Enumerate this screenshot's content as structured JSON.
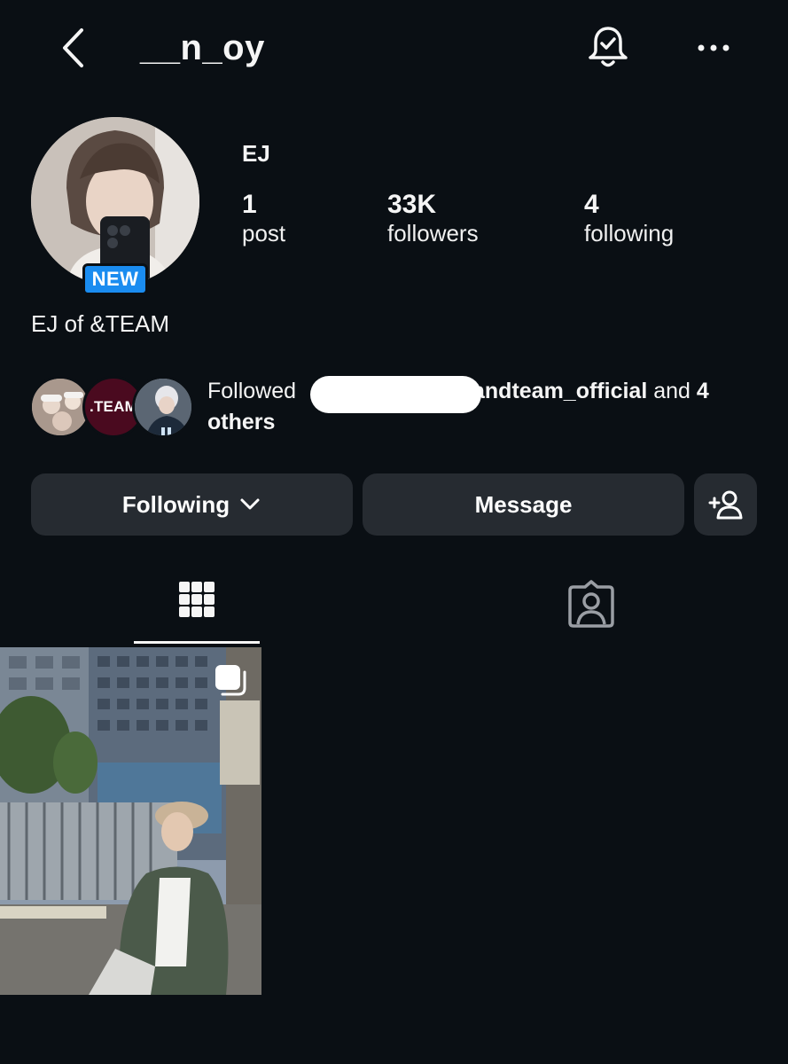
{
  "header": {
    "username": "__n_oy"
  },
  "profile": {
    "display_name": "EJ",
    "badge": "NEW",
    "bio": "EJ of &TEAM",
    "stats": [
      {
        "number": "1",
        "label": "post"
      },
      {
        "number": "33K",
        "label": "followers"
      },
      {
        "number": "4",
        "label": "following"
      }
    ]
  },
  "followed_by": {
    "prefix": "Followed ",
    "account": "andteam_official",
    "middle": " and ",
    "count": "4",
    "suffix": "others",
    "avatar_text": ".TEAM"
  },
  "actions": {
    "following_label": "Following",
    "message_label": "Message"
  },
  "colors": {
    "background": "#0a0f14",
    "button": "#262b31",
    "badge": "#1a8cf0"
  },
  "icons": [
    "back-icon",
    "bell-check-icon",
    "more-icon",
    "chevron-down-icon",
    "add-person-icon",
    "grid-icon",
    "tagged-icon",
    "multiple-posts-icon"
  ]
}
